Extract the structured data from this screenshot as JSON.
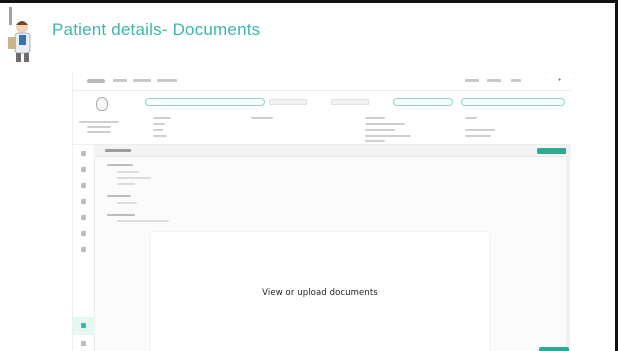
{
  "slide": {
    "title": "Patient details- Documents"
  },
  "colors": {
    "accent": "#3bb9a6",
    "button": "#2fa98f",
    "frame": "#111111"
  },
  "icons": {
    "mascot": "doctor-figure-icon",
    "avatar": "patient-avatar-icon"
  },
  "upload_panel": {
    "text": "View or upload documents"
  }
}
